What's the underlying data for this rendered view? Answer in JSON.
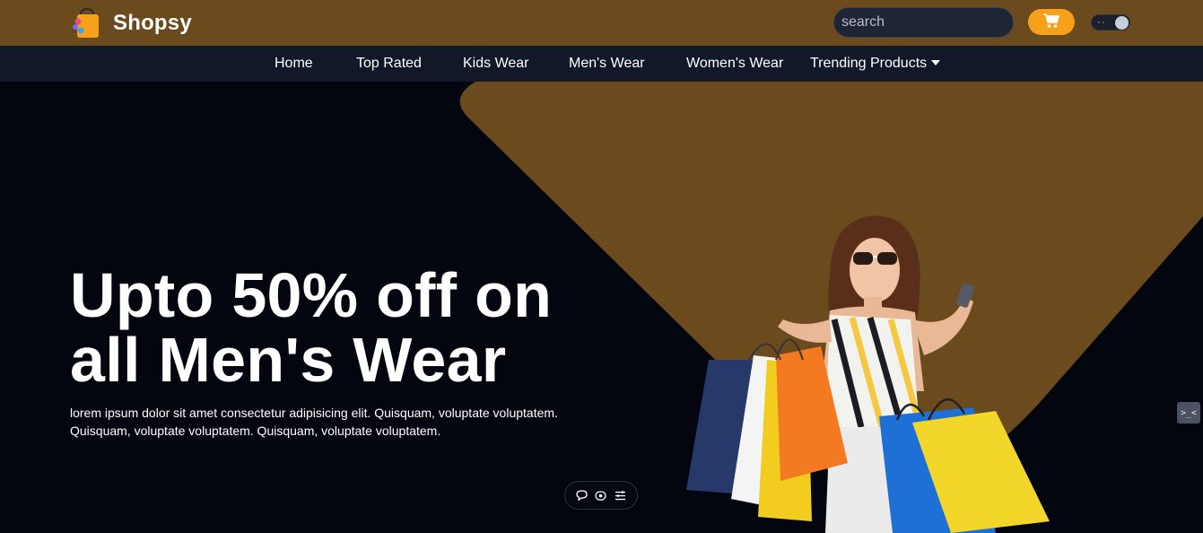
{
  "brand": {
    "name": "Shopsy",
    "logo_icon": "shopping-bag-logo-icon"
  },
  "header": {
    "search": {
      "placeholder": "search",
      "value": ""
    },
    "search_icon": "search-icon",
    "cart_icon": "shopping-cart-icon",
    "theme_toggle": "dark-mode-toggle"
  },
  "nav": {
    "items": [
      {
        "label": "Home"
      },
      {
        "label": "Top Rated"
      },
      {
        "label": "Kids Wear"
      },
      {
        "label": "Men's Wear"
      },
      {
        "label": "Women's Wear"
      },
      {
        "label": "Trending Products",
        "has_dropdown": true
      }
    ]
  },
  "hero": {
    "title_line1": "Upto 50% off on",
    "title_line2": "all Men's Wear",
    "description": "lorem ipsum dolor sit amet consectetur adipisicing elit. Quisquam, voluptate voluptatem. Quisquam, voluptate voluptatem. Quisquam, voluptate voluptatem."
  },
  "floating_toolbar": {
    "icons": [
      "chat-bubble-icon",
      "eye-icon",
      "menu-lines-icon"
    ]
  },
  "side_tab": {
    "label": ">_<"
  },
  "colors": {
    "topbar": "#6b4a1e",
    "navbar": "#111827",
    "hero_bg": "#03060f",
    "accent": "#f7a11a",
    "hero_shape": "#6b4a1e"
  }
}
